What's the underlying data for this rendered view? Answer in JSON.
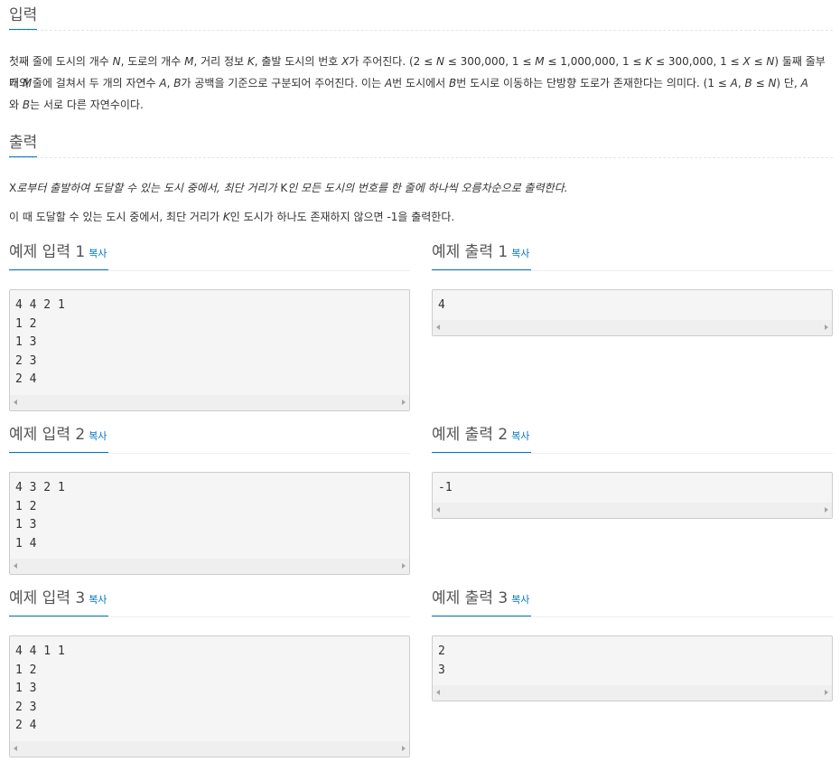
{
  "input_section": {
    "title": "입력",
    "p1_parts": [
      "첫째 줄에 도시의 개수 ",
      "N",
      ", 도로의 개수 ",
      "M",
      ", 거리 정보 ",
      "K",
      ", 출발 도시의 번호 ",
      "X",
      "가 주어진다. (2 ≤ ",
      "N",
      " ≤ 300,000, 1 ≤ ",
      "M",
      " ≤ 1,000,000, 1 ≤ ",
      "K",
      " ≤ 300,000, 1 ≤ ",
      "X",
      " ≤ ",
      "N",
      ") 둘째 줄부터 ",
      "M"
    ],
    "p2_parts": [
      "개의 줄에 걸쳐서 두 개의 자연수 ",
      "A",
      ", ",
      "B",
      "가 공백을 기준으로 구분되어 주어진다. 이는 ",
      "A",
      "번 도시에서 ",
      "B",
      "번 도시로 이동하는 단방향 도로가 존재한다는 의미다. (1 ≤ ",
      "A",
      ", ",
      "B",
      " ≤ ",
      "N",
      ") 단, ",
      "A"
    ],
    "p3_parts": [
      "와 ",
      "B",
      "는 서로 다른 자연수이다."
    ]
  },
  "output_section": {
    "title": "출력",
    "p1_parts": [
      "X",
      "로부터 출발하여 도달할 수 있는 도시 중에서, 최단 거리가 ",
      "K",
      "인 모든 도시의 번호를 한 줄에 하나씩 오름차순으로 출력한다."
    ],
    "p2_parts": [
      "이 때 도달할 수 있는 도시 중에서, 최단 거리가 ",
      "K",
      "인 도시가 하나도 존재하지 않으면 -1을 출력한다."
    ]
  },
  "copy_label": "복사",
  "samples": [
    {
      "input_title": "예제 입력 1",
      "input_lines": [
        "4 4 2 1",
        "1 2",
        "1 3",
        "2 3",
        "2 4"
      ],
      "output_title": "예제 출력 1",
      "output_lines": [
        "4"
      ]
    },
    {
      "input_title": "예제 입력 2",
      "input_lines": [
        "4 3 2 1",
        "1 2",
        "1 3",
        "1 4"
      ],
      "output_title": "예제 출력 2",
      "output_lines": [
        "-1"
      ]
    },
    {
      "input_title": "예제 입력 3",
      "input_lines": [
        "4 4 1 1",
        "1 2",
        "1 3",
        "2 3",
        "2 4"
      ],
      "output_title": "예제 출력 3",
      "output_lines": [
        "2",
        "3"
      ]
    }
  ]
}
